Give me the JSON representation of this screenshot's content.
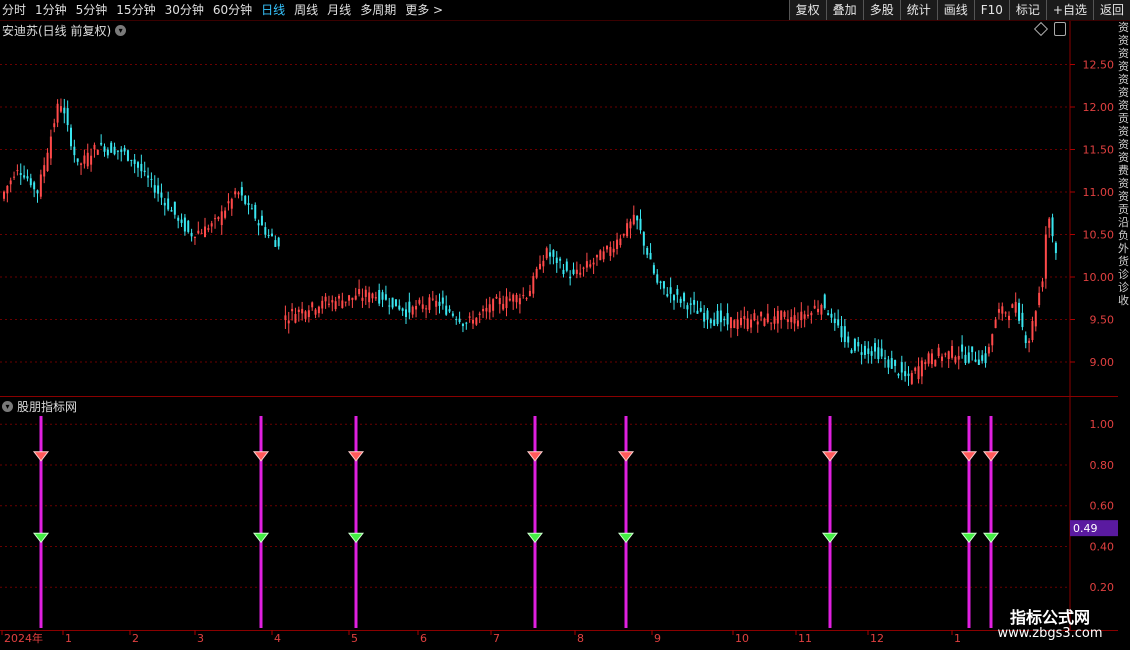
{
  "toolbar": {
    "periods": [
      "分时",
      "1分钟",
      "5分钟",
      "15分钟",
      "30分钟",
      "60分钟",
      "日线",
      "周线",
      "月线",
      "多周期",
      "更多"
    ],
    "active_period": "日线",
    "more_arrow": ">",
    "right_buttons": [
      "复权",
      "叠加",
      "多股",
      "统计",
      "画线",
      "F10",
      "标记",
      "+自选",
      "返回"
    ]
  },
  "main_chart": {
    "title": "安迪苏(日线 前复权)",
    "y_ticks": [
      "12.50",
      "12.00",
      "11.50",
      "11.00",
      "10.50",
      "10.00",
      "9.50",
      "9.00"
    ],
    "y_range": [
      8.6,
      12.8
    ],
    "up_color": "#ff4a4a",
    "down_color": "#3ae6f0"
  },
  "indicator_panel": {
    "title": "股朋指标网",
    "y_ticks": [
      "1.00",
      "0.80",
      "0.60",
      "0.40",
      "0.20"
    ],
    "y_range": [
      0,
      1.05
    ],
    "current_value": "0.49",
    "signal_color": "#e020e0",
    "red_marker_value": 0.85,
    "green_marker_value": 0.45
  },
  "x_axis": {
    "labels": [
      "2024年",
      "1",
      "2",
      "3",
      "4",
      "5",
      "6",
      "7",
      "8",
      "9",
      "10",
      "11",
      "12",
      "1"
    ]
  },
  "right_strip_text": "资资资资资资资贡资资资费资资贡沿负外货诊诊收",
  "watermark": {
    "title": "指标公式网",
    "url": "www.zbgs3.com"
  }
}
